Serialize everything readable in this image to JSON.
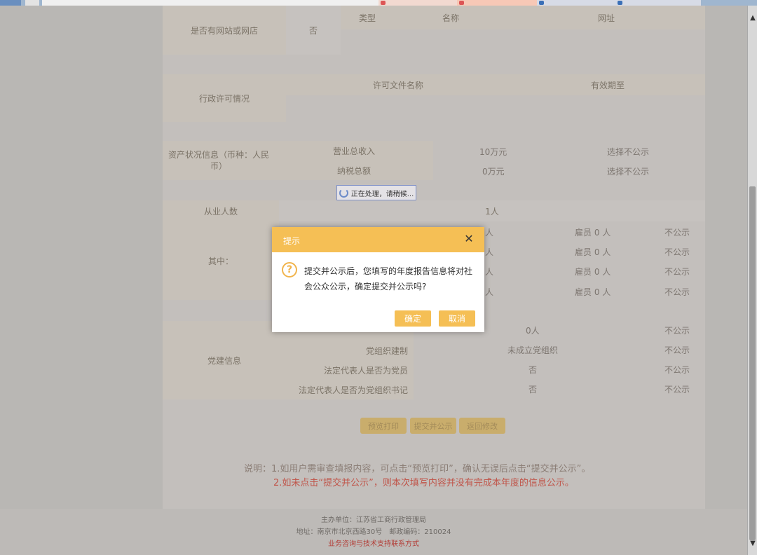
{
  "browser": {
    "tabs": [
      "",
      "",
      "",
      "",
      "",
      "",
      ""
    ]
  },
  "website": {
    "label": "是否有网站或网店",
    "value": "否",
    "headers": [
      "类型",
      "名称",
      "网址"
    ]
  },
  "license": {
    "label": "行政许可情况",
    "headers": [
      "许可文件名称",
      "有效期至"
    ]
  },
  "assets": {
    "label": "资产状况信息（币种：人民币）",
    "rows": [
      {
        "name": "营业总收入",
        "value": "10万元",
        "status": "选择不公示"
      },
      {
        "name": "纳税总额",
        "value": "0万元",
        "status": "选择不公示"
      }
    ]
  },
  "processing": "正在处理，请稍候...",
  "employees": {
    "label": "从业人数",
    "value": "1人",
    "sub_label": "其中：",
    "rows": [
      {
        "left": "人",
        "employed": "雇员 0 人",
        "status": "不公示"
      },
      {
        "left": "人",
        "employed": "雇员 0 人",
        "status": "不公示"
      },
      {
        "left": "人",
        "employed": "雇员 0 人",
        "status": "不公示"
      },
      {
        "left": "人",
        "employed": "雇员 0 人",
        "status": "不公示"
      }
    ]
  },
  "party": {
    "label": "党建信息",
    "rows": [
      {
        "name": "",
        "value": "0人",
        "status": "不公示"
      },
      {
        "name": "党组织建制",
        "value": "未成立党组织",
        "status": "不公示"
      },
      {
        "name": "法定代表人是否为党员",
        "value": "否",
        "status": "不公示"
      },
      {
        "name": "法定代表人是否为党组织书记",
        "value": "否",
        "status": "不公示"
      }
    ]
  },
  "actions": {
    "preview": "预览打印",
    "submit": "提交并公示",
    "back": "返回修改"
  },
  "notes": {
    "line1": "说明：1.如用户需审查填报内容，可点击“预览打印”，确认无误后点击“提交并公示”。",
    "line2": "2.如未点击“提交并公示”，则本次填写内容并没有完成本年度的信息公示。"
  },
  "footer": {
    "sponsor": "主办单位：江苏省工商行政管理局",
    "address": "地址：南京市北京西路30号　邮政编码：210024",
    "support": "业务咨询与技术支持联系方式"
  },
  "dialog": {
    "title": "提示",
    "message": "提交并公示后，您填写的年度报告信息将对社会公众公示，确定提交并公示吗?",
    "confirm": "确定",
    "cancel": "取消",
    "icon": "question-icon"
  },
  "colors": {
    "accent": "#f5bf55",
    "warning_text": "#c0554a"
  }
}
